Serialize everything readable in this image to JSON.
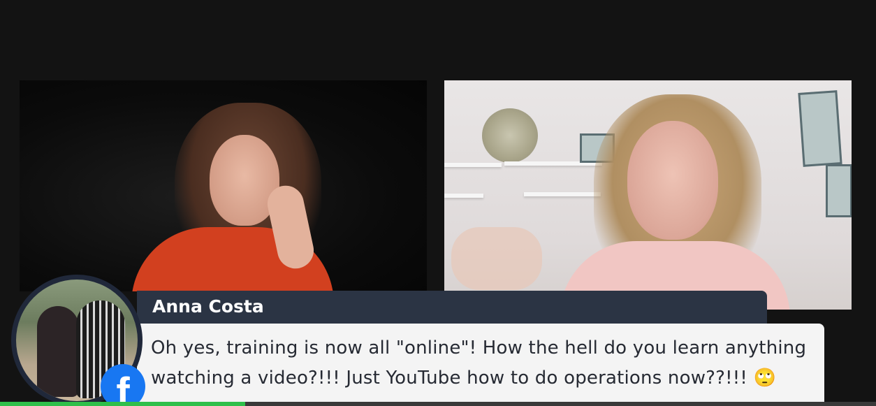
{
  "comment": {
    "author_name": "Anna Costa",
    "message": "Oh yes, training is now all \"online\"! How the hell do you learn anything watching a video?!!! Just YouTube how to do operations now??!!! 🙄",
    "platform_icon": "facebook-icon",
    "platform_glyph": "f"
  },
  "colors": {
    "name_bar": "#2b3444",
    "message_box": "#f4f4f4",
    "facebook_blue": "#1877f2",
    "progress": "#2fbf4a"
  },
  "playback": {
    "progress_fraction": 0.28
  }
}
